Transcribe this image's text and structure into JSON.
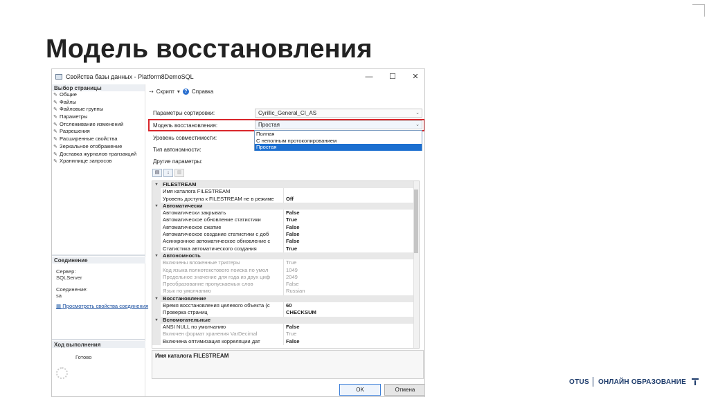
{
  "slide": {
    "title": "Модель восстановления"
  },
  "window": {
    "title": "Свойства базы данных - Platform8DemoSQL",
    "minimize": "—",
    "maximize": "☐",
    "close": "✕"
  },
  "sidebar": {
    "select_page_header": "Выбор страницы",
    "items": [
      "Общие",
      "Файлы",
      "Файловые группы",
      "Параметры",
      "Отслеживание изменений",
      "Разрешения",
      "Расширенные свойства",
      "Зеркальное отображение",
      "Доставка журналов транзакций",
      "Хранилище запросов"
    ],
    "connection_header": "Соединение",
    "server_label": "Сервер:",
    "server_value": "SQLServer",
    "connection_label": "Соединение:",
    "connection_value": "sa",
    "view_props_link": "Просмотреть свойства соединения",
    "progress_header": "Ход выполнения",
    "progress_status": "Готово"
  },
  "toolbar": {
    "script_label": "Скрипт",
    "help_label": "Справка"
  },
  "form": {
    "collation_label": "Параметры сортировки:",
    "collation_value": "Cyrillic_General_CI_AS",
    "recovery_label": "Модель восстановления:",
    "recovery_value": "Простая",
    "compat_label": "Уровень совместимости:",
    "containment_label": "Тип автономности:",
    "other_label": "Другие параметры:",
    "recovery_options": [
      "Полная",
      "С неполным протоколированием",
      "Простая"
    ],
    "recovery_selected_index": 2
  },
  "grid": {
    "rows": [
      {
        "type": "cat",
        "name": "FILESTREAM"
      },
      {
        "type": "prop",
        "name": "Имя каталога FILESTREAM",
        "value": ""
      },
      {
        "type": "prop",
        "name": "Уровень доступа к FILESTREAM не в режиме",
        "value": "Off"
      },
      {
        "type": "cat",
        "name": "Автоматически"
      },
      {
        "type": "prop",
        "name": "Автоматически закрывать",
        "value": "False"
      },
      {
        "type": "prop",
        "name": "Автоматическое обновление статистики",
        "value": "True"
      },
      {
        "type": "prop",
        "name": "Автоматическое сжатие",
        "value": "False"
      },
      {
        "type": "prop",
        "name": "Автоматическое создание статистики с доб",
        "value": "False"
      },
      {
        "type": "prop",
        "name": "Асинхронное автоматическое обновление с",
        "value": "False"
      },
      {
        "type": "prop",
        "name": "Статистика автоматического создания",
        "value": "True"
      },
      {
        "type": "cat",
        "name": "Автономность"
      },
      {
        "type": "dim",
        "name": "Включены вложенные триггеры",
        "value": "True"
      },
      {
        "type": "dim",
        "name": "Код языка полнотекстового поиска по умол",
        "value": "1049"
      },
      {
        "type": "dim",
        "name": "Предельное значение для года из двух циф",
        "value": "2049"
      },
      {
        "type": "dim",
        "name": "Преобразование пропускаемых слов",
        "value": "False"
      },
      {
        "type": "dim",
        "name": "Язык по умолчанию",
        "value": "Russian"
      },
      {
        "type": "cat",
        "name": "Восстановление"
      },
      {
        "type": "prop",
        "name": "Время восстановления целевого объекта (с",
        "value": "60"
      },
      {
        "type": "prop",
        "name": "Проверка страниц",
        "value": "CHECKSUM"
      },
      {
        "type": "cat",
        "name": "Вспомогательные"
      },
      {
        "type": "prop",
        "name": "ANSI NULL по умолчанию",
        "value": "False"
      },
      {
        "type": "dim",
        "name": "Включен формат хранения VarDecimal",
        "value": "True"
      },
      {
        "type": "prop",
        "name": "Включена оптимизация корреляции дат",
        "value": "False"
      }
    ]
  },
  "description": {
    "text": "Имя каталога FILESTREAM"
  },
  "buttons": {
    "ok": "OK",
    "cancel": "Отмена"
  },
  "footer": {
    "brand": "OTUS",
    "tagline": "ОНЛАЙН ОБРАЗОВАНИЕ"
  },
  "colors": {
    "highlight": "#d9262b",
    "selected": "#1c6fd0",
    "brand": "#1d3b6b"
  }
}
